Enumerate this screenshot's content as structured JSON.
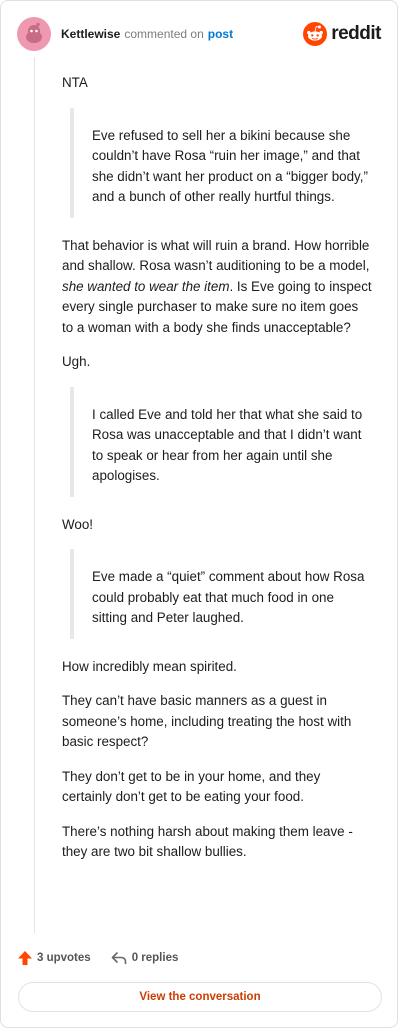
{
  "header": {
    "author": "Kettlewise",
    "action": "commented on",
    "link": "post",
    "logo_text": "reddit"
  },
  "comment": {
    "p1": "NTA",
    "q1": "Eve refused to sell her a bikini because she couldn’t have Rosa “ruin her image,” and that she didn’t want her product on a “bigger body,” and a bunch of other really hurtful things.",
    "p2a": "That behavior is what will ruin a brand. How horrible and shallow. Rosa wasn’t auditioning to be a model, ",
    "p2b": "she wanted to wear the item",
    "p2c": ". Is Eve going to inspect every single purchaser to make sure no item goes to a woman with a body she finds unacceptable?",
    "p3": "Ugh.",
    "q2": "I called Eve and told her that what she said to Rosa was unacceptable and that I didn’t want to speak or hear from her again until she apologises.",
    "p4": "Woo!",
    "q3": "Eve made a “quiet” comment about how Rosa could probably eat that much food in one sitting and Peter laughed.",
    "p5": "How incredibly mean spirited.",
    "p6": "They can’t have basic manners as a guest in someone’s home, including treating the host with basic respect?",
    "p7": "They don’t get to be in your home, and they certainly don’t get to be eating your food.",
    "p8": "There’s nothing harsh about making them leave - they are two bit shallow bullies."
  },
  "footer": {
    "upvotes": "3 upvotes",
    "replies": "0 replies",
    "cta": "View the conversation"
  },
  "colors": {
    "reddit_orange": "#ff4500",
    "link_blue": "#0079d3",
    "cta_text": "#cc3d00",
    "avatar_bg": "#ee99b0"
  },
  "icons": {
    "avatar": "snoo-avatar-icon",
    "logo": "reddit-snoo-icon",
    "upvote": "upvote-arrow-icon",
    "reply": "reply-arrow-icon"
  }
}
